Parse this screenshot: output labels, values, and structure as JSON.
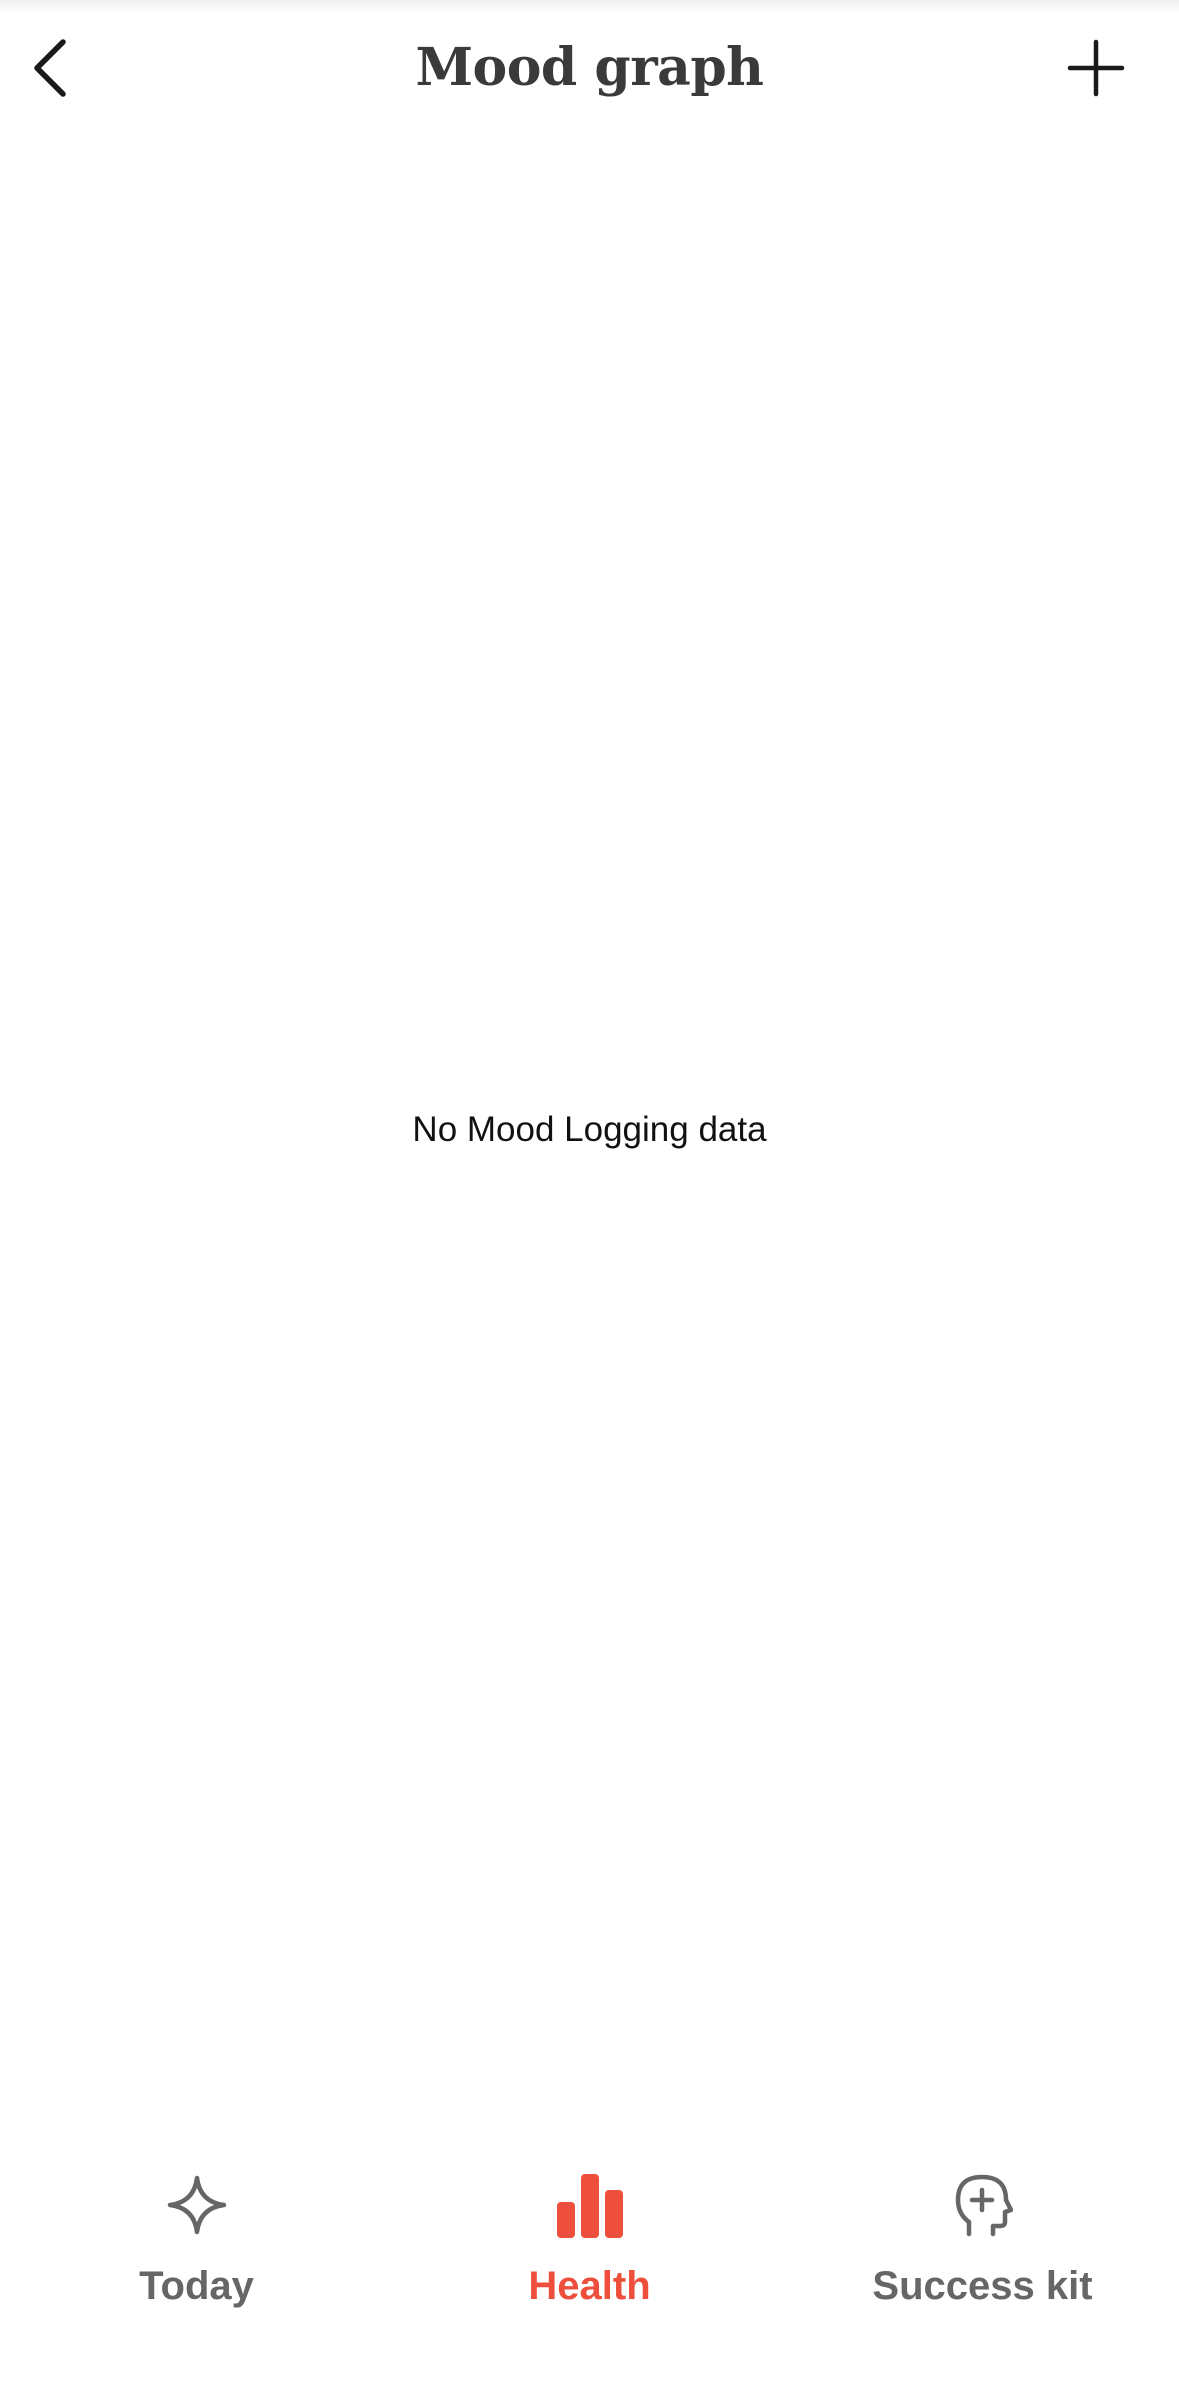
{
  "header": {
    "title": "Mood graph",
    "back_icon": "chevron-left-icon",
    "add_icon": "plus-icon"
  },
  "main": {
    "empty_message": "No Mood Logging data"
  },
  "tab_bar": {
    "tabs": [
      {
        "label": "Today",
        "icon": "sparkle-icon",
        "active": false
      },
      {
        "label": "Health",
        "icon": "bar-chart-icon",
        "active": true
      },
      {
        "label": "Success kit",
        "icon": "head-plus-icon",
        "active": false
      }
    ]
  },
  "colors": {
    "accent": "#ee4f3c",
    "inactive": "#666666",
    "text": "#111111",
    "background": "#ffffff"
  }
}
